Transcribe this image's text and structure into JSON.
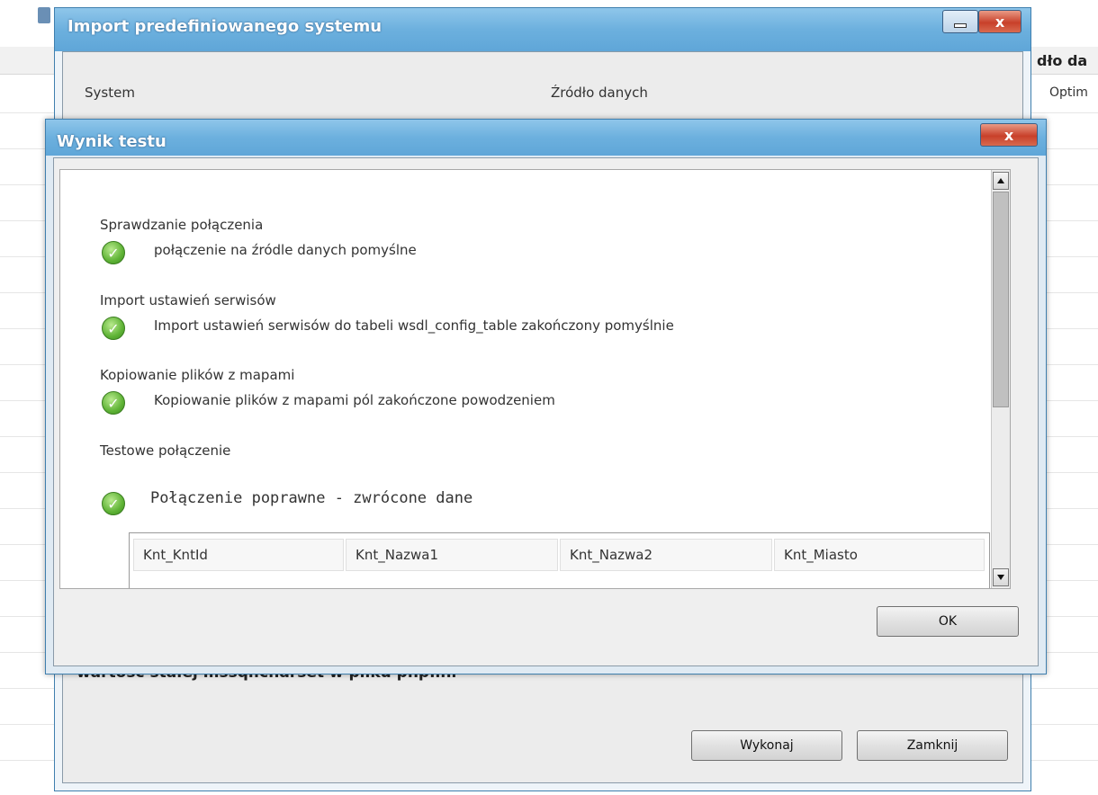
{
  "background": {
    "right_header": "dło da",
    "right_cell": "Optim"
  },
  "outer_window": {
    "title": "Import predefiniowanego systemu",
    "minimize_icon": "minimize-icon",
    "close_label": "x",
    "label_system": "System",
    "label_source": "Źródło danych",
    "bottom_text": "- wartosc stałej mssql.charset w pliku php.ini -",
    "execute_button": "Wykonaj",
    "close_button": "Zamknij"
  },
  "inner_window": {
    "title": "Wynik testu",
    "close_label": "x",
    "sections": [
      {
        "title": "Sprawdzanie połączenia",
        "result": "połączenie na źródle danych pomyślne"
      },
      {
        "title": "Import ustawień serwisów",
        "result": "Import ustawień serwisów do tabeli wsdl_config_table zakończony pomyślnie"
      },
      {
        "title": "Kopiowanie plików z mapami",
        "result": "Kopiowanie plików z mapami pól zakończone powodzeniem"
      },
      {
        "title": "Testowe połączenie",
        "result": "Połączenie poprawne - zwrócone dane"
      }
    ],
    "table_columns": [
      "Knt_KntId",
      "Knt_Nazwa1",
      "Knt_Nazwa2",
      "Knt_Miasto"
    ],
    "ok_button": "OK",
    "check_icon": "check-icon",
    "check_glyph": "✓"
  },
  "colors": {
    "titlebar": "#6cb0de",
    "close_red": "#c8402a",
    "check_green": "#5fb336"
  }
}
